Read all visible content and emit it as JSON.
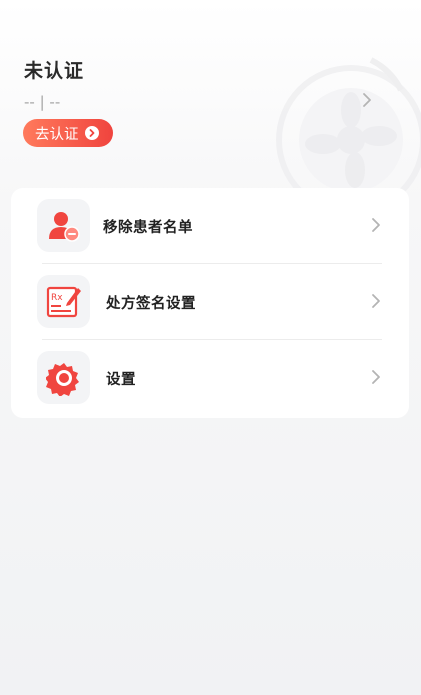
{
  "profile": {
    "status_title": "未认证",
    "sub_line": "-- | --",
    "verify_button_label": "去认证"
  },
  "menu": {
    "items": [
      {
        "label": "移除患者名单",
        "icon": "remove-patient-icon"
      },
      {
        "label": "处方签名设置",
        "icon": "prescription-sign-icon"
      },
      {
        "label": "设置",
        "icon": "settings-gear-icon"
      }
    ]
  },
  "colors": {
    "accent": "#f0443e",
    "accent_light": "#ff7a5c",
    "chevron": "#b4b4b4"
  }
}
